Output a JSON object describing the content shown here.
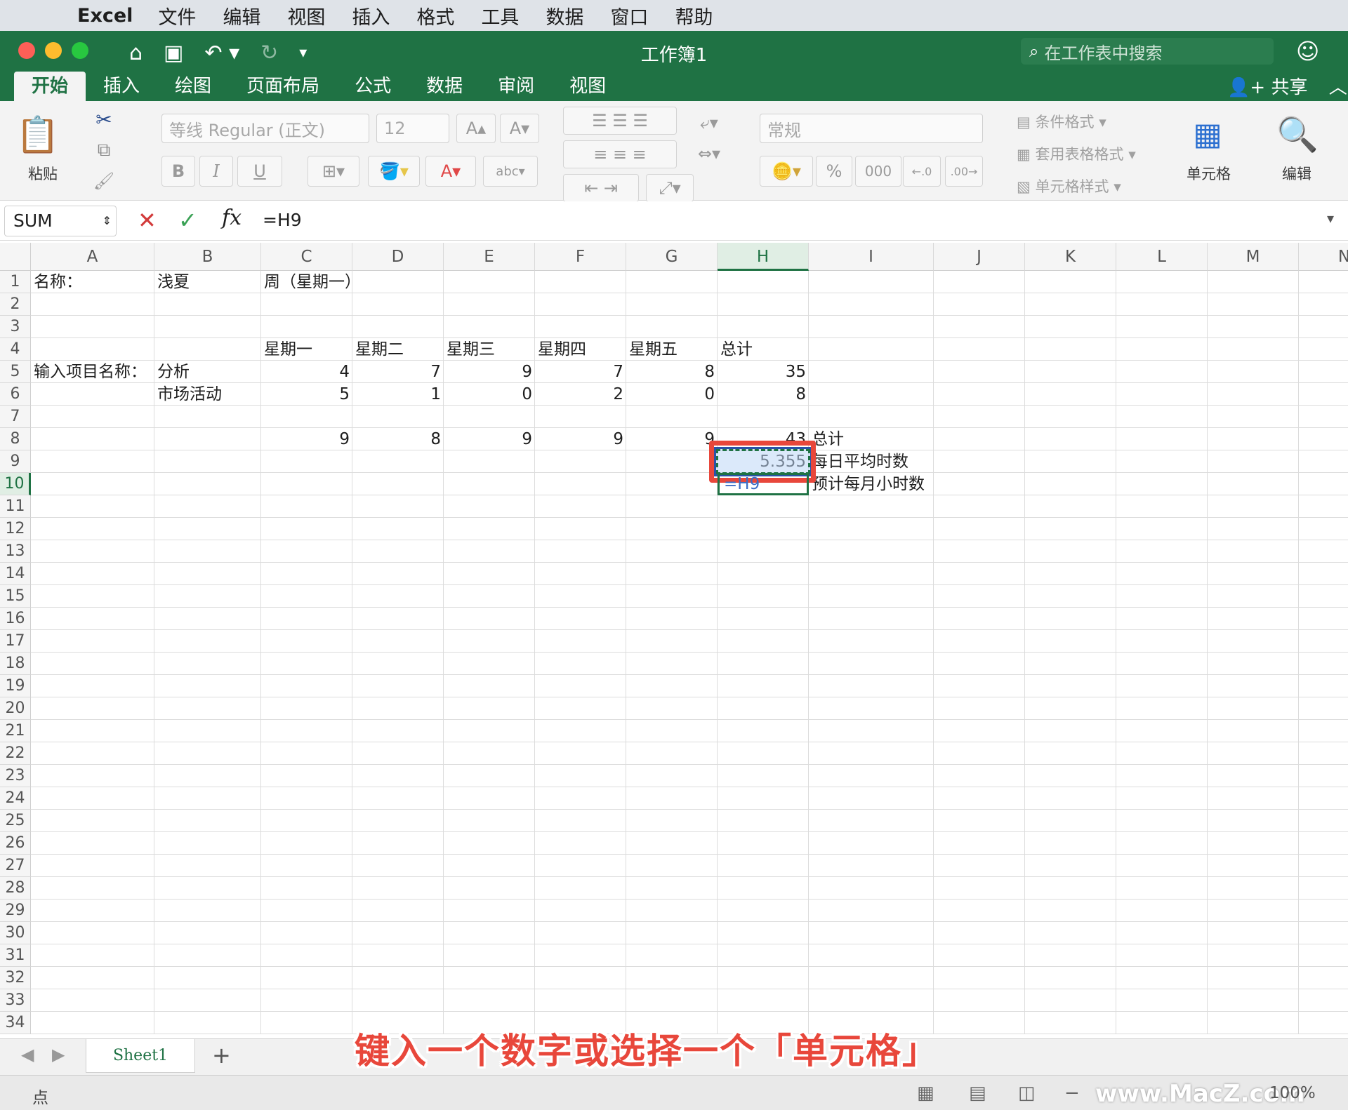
{
  "menubar": {
    "app_name": "Excel",
    "items": [
      "文件",
      "编辑",
      "视图",
      "插入",
      "格式",
      "工具",
      "数据",
      "窗口",
      "帮助"
    ]
  },
  "window": {
    "title": "工作簿1",
    "search_placeholder": "在工作表中搜索",
    "share_label": "共享"
  },
  "tabs": [
    "开始",
    "插入",
    "绘图",
    "页面布局",
    "公式",
    "数据",
    "审阅",
    "视图"
  ],
  "active_tab": "开始",
  "ribbon": {
    "paste_label": "粘贴",
    "font_name": "等线 Regular (正文)",
    "font_size": "12",
    "number_format": "常规",
    "conditional_format": "条件格式",
    "table_format": "套用表格格式",
    "cell_styles": "单元格样式",
    "cells_label": "单元格",
    "edit_label": "编辑",
    "bold": "B",
    "italic": "I",
    "underline": "U",
    "percent": "%",
    "thousands": "000"
  },
  "formula_bar": {
    "name_box": "SUM",
    "formula": "=H9",
    "fx": "fx"
  },
  "columns": [
    "A",
    "B",
    "C",
    "D",
    "E",
    "F",
    "G",
    "H",
    "I",
    "J",
    "K",
    "L",
    "M",
    "N"
  ],
  "selected_column": "H",
  "rows": [
    "1",
    "2",
    "3",
    "4",
    "5",
    "6",
    "7",
    "8",
    "9",
    "10",
    "11",
    "12",
    "13",
    "14",
    "15",
    "16",
    "17",
    "18",
    "19",
    "20",
    "21",
    "22",
    "23",
    "24",
    "25",
    "26",
    "27",
    "28",
    "29",
    "30",
    "31",
    "32",
    "33",
    "34"
  ],
  "selected_row": "10",
  "cells": {
    "A1": "名称：",
    "B1": "浅夏",
    "C1": "周（星期一）",
    "C4": "星期一",
    "D4": "星期二",
    "E4": "星期三",
    "F4": "星期四",
    "G4": "星期五",
    "H4": "总计",
    "A5": "输入项目名称：",
    "B5": "分析",
    "C5": "4",
    "D5": "7",
    "E5": "9",
    "F5": "7",
    "G5": "8",
    "H5": "35",
    "B6": "市场活动",
    "C6": "5",
    "D6": "1",
    "E6": "0",
    "F6": "2",
    "G6": "0",
    "H6": "8",
    "C8": "9",
    "D8": "8",
    "E8": "9",
    "F8": "9",
    "G8": "9",
    "H8": "43",
    "I8": "总计",
    "H9": "5.355",
    "I9": "每日平均时数",
    "H10": "=H9",
    "I10": "预计每月小时数"
  },
  "sheet": {
    "tab_name": "Sheet1",
    "add_label": "+"
  },
  "caption": "键入一个数字或选择一个「单元格」",
  "status": {
    "mode": "点",
    "watermark": "www.MacZ.com",
    "zoom": "100%"
  },
  "colors": {
    "excel_green": "#1f7244",
    "highlight_red": "#e8473b",
    "reference_blue": "#2952a8"
  }
}
